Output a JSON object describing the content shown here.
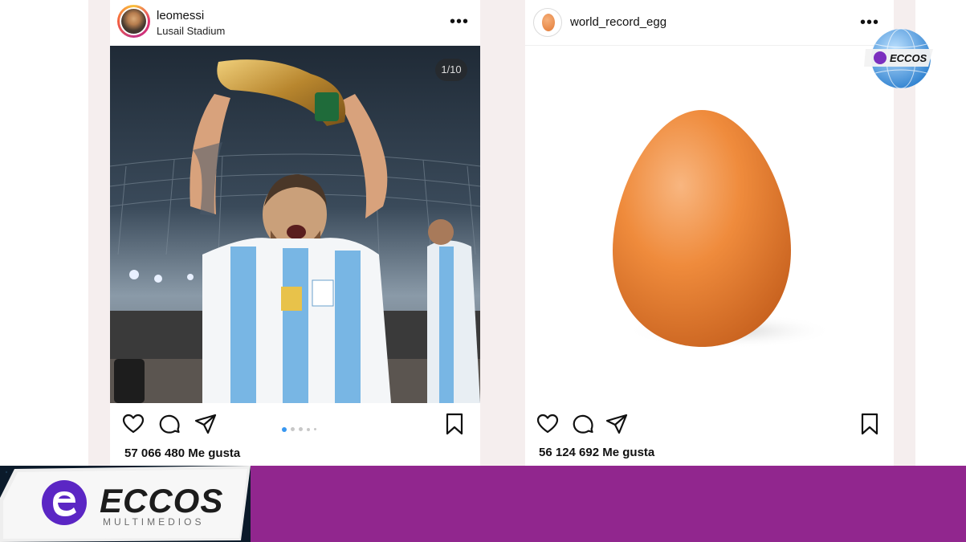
{
  "posts": [
    {
      "username": "leomessi",
      "location": "Lusail Stadium",
      "image_counter": "1/10",
      "likes": "57 066 480 Me gusta",
      "carousel": {
        "count": 5,
        "active": 1
      }
    },
    {
      "username": "world_record_egg",
      "likes": "56 124 692 Me gusta"
    }
  ],
  "watermark": {
    "brand": "ECCOS",
    "sub": "MULTIMEDIOS",
    "small_brand": "ECCOS"
  },
  "colors": {
    "brand_purple": "#91268e",
    "carousel_active": "#3897f0",
    "egg": "#ef8b3c"
  },
  "icons": [
    "heart-icon",
    "comment-icon",
    "share-icon",
    "bookmark-icon",
    "more-icon",
    "globe-logo",
    "eccos-logo"
  ]
}
